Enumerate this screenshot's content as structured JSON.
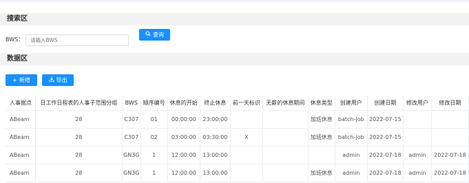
{
  "search_section": {
    "title": "搜索区",
    "bws_label": "BWS：",
    "bws_placeholder": "请输入BWS",
    "query_button": "查询"
  },
  "data_section": {
    "title": "数据区",
    "add_button": "新增",
    "export_button": "导出"
  },
  "table": {
    "columns": [
      "人事据点",
      "日工作日程表的人事子范围分组",
      "BWS",
      "顺序编号",
      "休息的开始",
      "终止休息",
      "前一天标识",
      "无薪的休息期间",
      "休息类型",
      "创建用户",
      "创建日期",
      "修改用户",
      "修改日期"
    ],
    "rows": [
      [
        "ABeam",
        "28",
        "C307",
        "01",
        "00:00:00",
        "23:00:00",
        "",
        "",
        "加班休息",
        "batch-job",
        "2022-07-15",
        "",
        ""
      ],
      [
        "ABeam",
        "28",
        "C307",
        "02",
        "03:00:00",
        "03:30:00",
        "X",
        "",
        "加班休息",
        "batch-job",
        "2022-07-15",
        "",
        ""
      ],
      [
        "ABeam",
        "28",
        "GN3G",
        "1",
        "12:00:00",
        "13:00:00",
        "",
        "",
        "",
        "admin",
        "2022-07-18",
        "admin",
        "2022-07-18"
      ],
      [
        "ABeam",
        "28",
        "GN3G",
        "1",
        "12:00:00",
        "13:00:00",
        "",
        "",
        "加班休息",
        "admin",
        "2022-07-18",
        "admin",
        "2022-07-18"
      ]
    ]
  }
}
